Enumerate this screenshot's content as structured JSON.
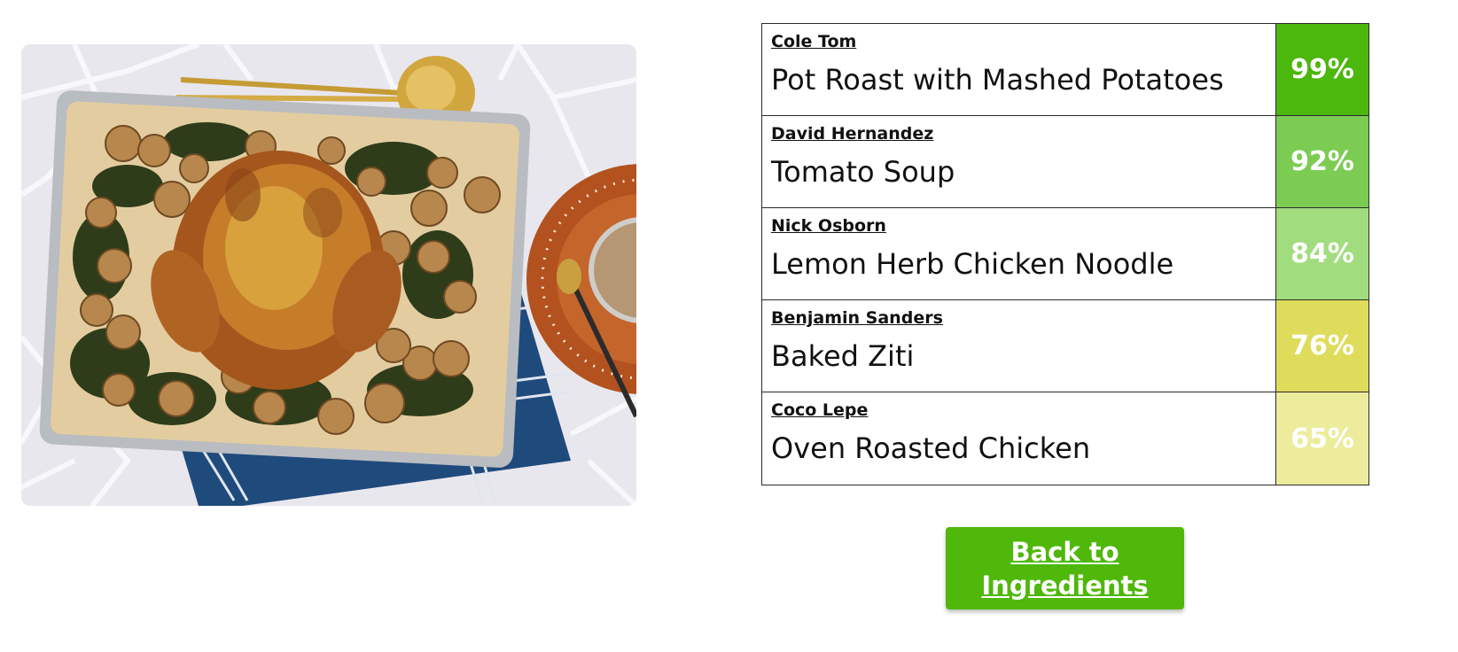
{
  "photo": {
    "alt_icon": "roast-chicken-photo"
  },
  "results": [
    {
      "author": "Cole Tom",
      "dish": "Pot Roast with Mashed Potatoes",
      "score": "99%",
      "color": "#4cb70c"
    },
    {
      "author": "David Hernandez",
      "dish": "Tomato Soup",
      "score": "92%",
      "color": "#7ccc53"
    },
    {
      "author": "Nick Osborn",
      "dish": "Lemon Herb Chicken Noodle",
      "score": "84%",
      "color": "#a1dc7f"
    },
    {
      "author": "Benjamin Sanders",
      "dish": "Baked Ziti",
      "score": "76%",
      "color": "#dfdc5b"
    },
    {
      "author": "Coco Lepe",
      "dish": "Oven Roasted Chicken",
      "score": "65%",
      "color": "#ecec9c"
    }
  ],
  "back_button": {
    "label": "Back to Ingredients"
  }
}
